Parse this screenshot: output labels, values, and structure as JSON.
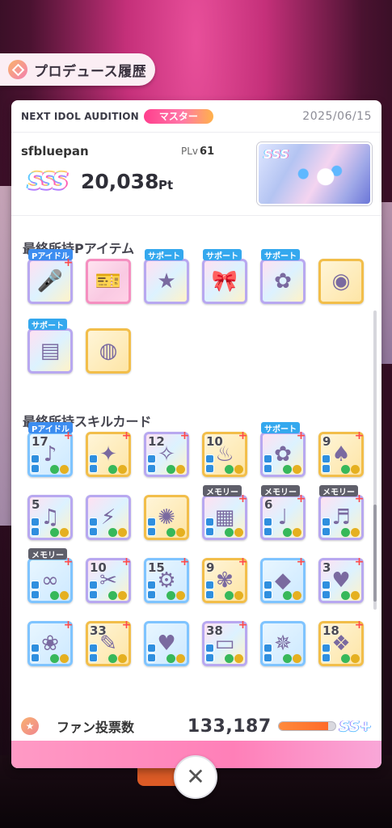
{
  "header": {
    "title": "プロデュース履歴"
  },
  "audition": {
    "name": "NEXT IDOL AUDITION",
    "difficulty": "マスター",
    "date": "2025/06/15"
  },
  "player": {
    "name": "sfbluepan",
    "plv_label": "PLv",
    "plv_value": "61",
    "rank": "SSS",
    "score": "20,038",
    "score_unit": "Pt"
  },
  "items_section": {
    "title": "最終所持Pアイテム",
    "items": [
      {
        "tag": "Pアイドル",
        "tag_type": "pidol",
        "icon": "microphone-icon",
        "plus": "+"
      },
      {
        "tag": "",
        "icon": "ticket-icon"
      },
      {
        "tag": "サポート",
        "tag_type": "support",
        "icon": "star-bracelet-icon"
      },
      {
        "tag": "サポート",
        "tag_type": "support",
        "icon": "ribbon-icon"
      },
      {
        "tag": "サポート",
        "tag_type": "support",
        "icon": "flower-card-icon"
      },
      {
        "tag": "",
        "icon": "audition-badge-icon"
      },
      {
        "tag": "サポート",
        "tag_type": "support",
        "icon": "notebook-icon"
      },
      {
        "tag": "",
        "icon": "wristband-icon"
      }
    ]
  },
  "skills_section": {
    "title": "最終所持スキルカード",
    "cards": [
      {
        "tag": "Pアイドル",
        "tag_type": "pidol",
        "num": "17",
        "plus": "+"
      },
      {
        "tag": "",
        "num": "",
        "plus": "+"
      },
      {
        "tag": "",
        "num": "12",
        "plus": "+"
      },
      {
        "tag": "",
        "num": "10",
        "plus": "+"
      },
      {
        "tag": "サポート",
        "tag_type": "support",
        "num": "",
        "plus": "+"
      },
      {
        "tag": "",
        "num": "9",
        "plus": "+"
      },
      {
        "tag": "",
        "num": "5",
        "plus": ""
      },
      {
        "tag": "",
        "num": "",
        "plus": ""
      },
      {
        "tag": "",
        "num": "",
        "plus": ""
      },
      {
        "tag": "メモリー",
        "tag_type": "memory",
        "num": "",
        "plus": "+"
      },
      {
        "tag": "メモリー",
        "tag_type": "memory",
        "num": "6",
        "plus": "+"
      },
      {
        "tag": "メモリー",
        "tag_type": "memory",
        "num": "",
        "plus": "+"
      },
      {
        "tag": "メモリー",
        "tag_type": "memory",
        "num": "",
        "plus": "+"
      },
      {
        "tag": "",
        "num": "10",
        "plus": "+"
      },
      {
        "tag": "",
        "num": "15",
        "plus": "+"
      },
      {
        "tag": "",
        "num": "9",
        "plus": "+"
      },
      {
        "tag": "",
        "num": "",
        "plus": "+"
      },
      {
        "tag": "",
        "num": "3",
        "plus": "+"
      },
      {
        "tag": "",
        "num": "",
        "plus": "+"
      },
      {
        "tag": "",
        "num": "33",
        "plus": "+"
      },
      {
        "tag": "",
        "num": "",
        "plus": ""
      },
      {
        "tag": "",
        "num": "38",
        "plus": "+"
      },
      {
        "tag": "",
        "num": "",
        "plus": ""
      },
      {
        "tag": "",
        "num": "18",
        "plus": "+"
      }
    ]
  },
  "fan_votes": {
    "label": "ファン投票数",
    "value": "133,187",
    "rank": "SS+",
    "progress_fraction": 0.88
  },
  "close_label": "✕"
}
